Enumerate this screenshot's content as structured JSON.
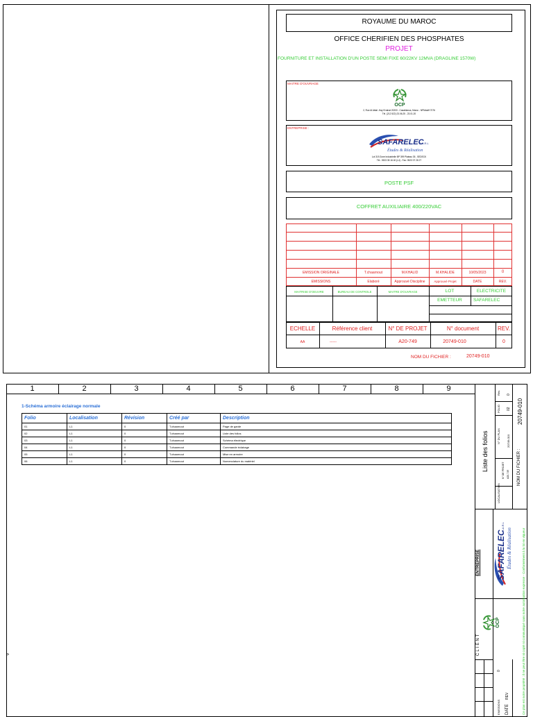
{
  "cover": {
    "country": "ROYAUME DU MAROC",
    "company": "OFFICE CHERIFIEN DES PHOSPHATES",
    "projet_label": "PROJET",
    "project_title": "FOURNITURE ET INSTALLATION D'UN POSTE SEMI FIXE 60/22KV 12MVA (DRAGLINE 1570W)",
    "maitre_label": "MAITRE D'OUVRAGE",
    "ocp_logo_text": "OCP",
    "ocp_address": "2, Rue Al Abtal -Hay Errahat 20200 - Casablanca, Maroc - NPMaloff 7076",
    "ocp_phone": "Tél. (212 522) 23.06.25 - 23.01.20",
    "entreprise_label": "ENTREPRISE :",
    "safarelec_name": "SAFARELEC",
    "safarelec_suffix": "S.A.R.L",
    "safarelec_tagline": "Études & Réalisation",
    "safarelec_address": "Lot 319 Zone Industrielle BP 399 Plateau 35 , SEDECK",
    "safarelec_phone": "Tél.: 0523 35 16 40 (L4) - Fax: 0523 07 28 27",
    "poste": "POSTE PSF",
    "coffret": "COFFRET AUXILIAIRE 400/220VAC",
    "rev_row": {
      "emission": "EMISSION ORIGINALE",
      "by1": "T.chaarnout",
      "by2": "M.KHALID",
      "by3": "M.KHALIDE",
      "date": "10/05/2023",
      "rev": "0"
    },
    "rev_header": {
      "emissions": "EMISSIONS",
      "elabore": "Elaboré",
      "discipline": "Approuvé Discipline",
      "projet": "Approuvé Projet",
      "date": "DATE",
      "rev": "REV."
    },
    "maitrise_oeuvre": "MAITRISE D'OEUVRE",
    "bureau_controle": "BUREAU DE CONTROLE",
    "maitre_ouvrage2": "MAITRE D'OUVRAGE",
    "lot_label": "LOT",
    "lot_value": "ELECTRICITE",
    "emetteur_label": "EMETTEUR",
    "emetteur_value": "SAFARELEC",
    "echelle_label": "ECHELLE",
    "ref_client_label": "Référence client",
    "projet_no_label": "N° DE PROJET",
    "doc_no_label": "N° document",
    "rev_label": "REV.",
    "echelle_value": "AA",
    "ref_client_value": "------",
    "projet_no_value": "A20-749",
    "doc_no_value": "20749-010",
    "rev_value": "0",
    "nom_fichier_label": "NOM DU FICHIER :",
    "nom_fichier_value": "20749-010"
  },
  "sheet": {
    "columns": [
      "1",
      "2",
      "3",
      "4",
      "5",
      "6",
      "7",
      "8",
      "9"
    ],
    "section_title": "1-Schéma  armoire éclairage normale",
    "table_headers": [
      "Folio",
      "Localisation",
      "Révision",
      "Créé par",
      "Description"
    ],
    "rows": [
      [
        "01",
        "L1",
        "0",
        "T.chaarnout",
        "Page de garde"
      ],
      [
        "02",
        "L1",
        "0",
        "T.chaarnout",
        "Liste des folios"
      ],
      [
        "03",
        "L1",
        "0",
        "T.chaarnout",
        "Schéma électrique"
      ],
      [
        "04",
        "L1",
        "0",
        "T.chaarnout",
        "Commande éclairage"
      ],
      [
        "05",
        "L1",
        "0",
        "T.chaarnout",
        "Mise en armoire"
      ],
      [
        "06",
        "L1",
        "0",
        "T.chaarnout",
        "Nomenclature du matériel"
      ]
    ],
    "right_title": "Liste des folios",
    "nom_fichier": "NOM DU FICHIER :",
    "doc_no": "20749-010",
    "rev_label": "Rév.",
    "rev_value": "0",
    "folio_label": "FOLIO",
    "folio_value": "02",
    "plan_label": "N° DU PLAN",
    "plan_value": "20749-010",
    "loc_label": "LOCALISATION",
    "projet_label": "N° DE PROJET",
    "projet_value": "A20-749",
    "entreprise": "ENTREPRISE",
    "client": "CLIENT",
    "safarelec_name": "SAFARELEC",
    "safarelec_suffix": "S.A.R.L",
    "safarelec_tagline": "Études & Réalisation",
    "ocp_logo_text": "OCP",
    "copyright": "Ce plan est notre propriété ; il ne peut être ni copié ni communiqué sans notre autorisation expresse - Conformément à la loi en vigueur",
    "date_label": "DATE",
    "rev_small": "REV",
    "emis_value": "0",
    "emis_label": "EMISSIONS"
  }
}
